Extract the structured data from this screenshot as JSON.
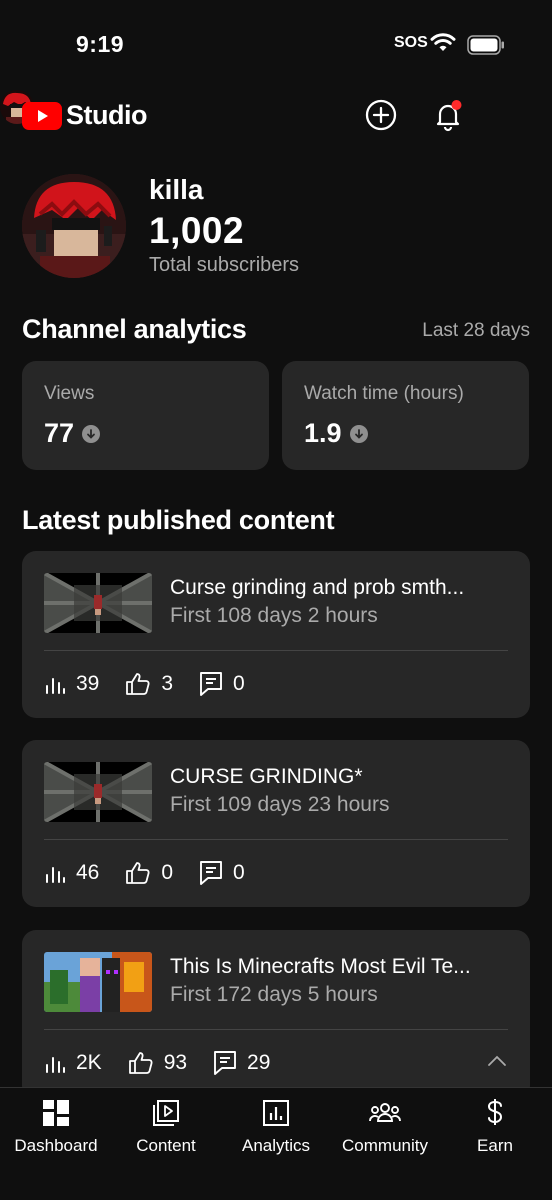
{
  "status_bar": {
    "time": "9:19",
    "carrier": "SOS"
  },
  "header": {
    "logo_text": "Studio",
    "brand_color": "#ff0000",
    "icons": [
      "create-icon",
      "bell-icon",
      "avatar"
    ]
  },
  "channel": {
    "name": "killa",
    "subscribers": "1,002",
    "subscribers_label": "Total subscribers"
  },
  "analytics": {
    "title": "Channel analytics",
    "period": "Last 28 days",
    "cards": [
      {
        "label": "Views",
        "value": "77",
        "trend": "down"
      },
      {
        "label": "Watch time (hours)",
        "value": "1.9",
        "trend": "down"
      }
    ]
  },
  "latest": {
    "title": "Latest published content",
    "videos": [
      {
        "title": "Curse grinding and prob smth...",
        "age": "First 108 days 2 hours",
        "views": "39",
        "likes": "3",
        "comments": "0"
      },
      {
        "title": "CURSE GRINDING*",
        "age": "First 109 days 23 hours",
        "views": "46",
        "likes": "0",
        "comments": "0"
      },
      {
        "title": "This Is Minecrafts Most Evil Te...",
        "age": "First 172 days 5 hours",
        "views": "2K",
        "likes": "93",
        "comments": "29"
      }
    ]
  },
  "bottom_nav": {
    "items": [
      {
        "label": "Dashboard",
        "icon": "dashboard-icon"
      },
      {
        "label": "Content",
        "icon": "content-icon"
      },
      {
        "label": "Analytics",
        "icon": "analytics-icon"
      },
      {
        "label": "Community",
        "icon": "community-icon"
      },
      {
        "label": "Earn",
        "icon": "earn-icon"
      }
    ]
  }
}
